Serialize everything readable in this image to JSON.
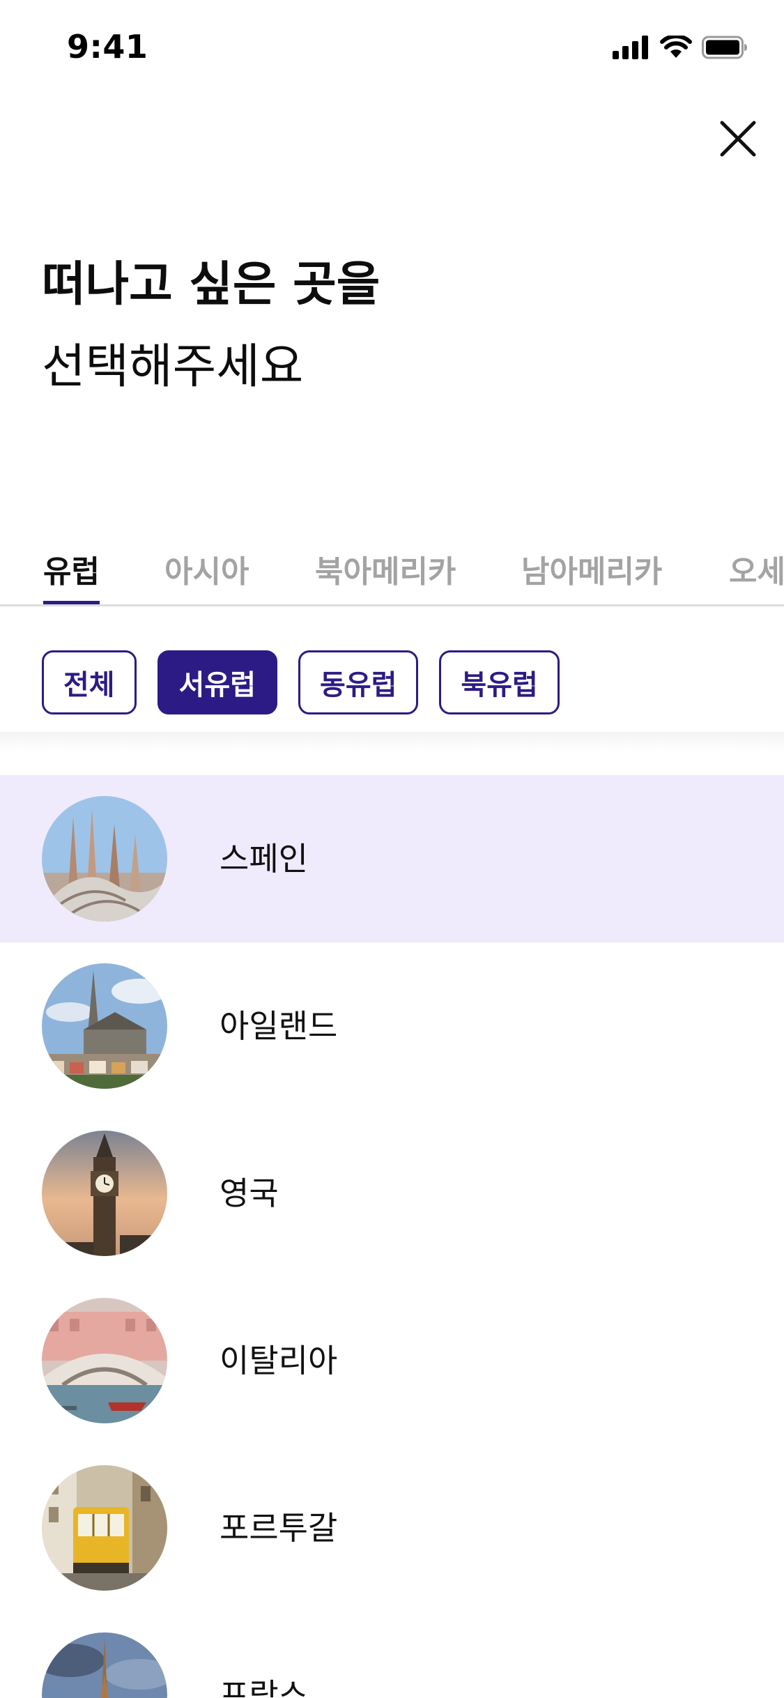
{
  "status_bar": {
    "time": "9:41",
    "icons": [
      "cellular-signal-icon",
      "wifi-icon",
      "battery-icon"
    ]
  },
  "close_icon": "close-icon",
  "title": {
    "line1": "떠나고 싶은 곳을",
    "line2": "선택해주세요"
  },
  "region_tabs": [
    {
      "label": "유럽",
      "active": true
    },
    {
      "label": "아시아",
      "active": false
    },
    {
      "label": "북아메리카",
      "active": false
    },
    {
      "label": "남아메리카",
      "active": false
    },
    {
      "label": "오세",
      "active": false
    }
  ],
  "sub_filters": [
    {
      "label": "전체",
      "selected": false
    },
    {
      "label": "서유럽",
      "selected": true
    },
    {
      "label": "동유럽",
      "selected": false
    },
    {
      "label": "북유럽",
      "selected": false
    }
  ],
  "countries": [
    {
      "name": "스페인",
      "selected": true,
      "image": "sagrada-familia-photo"
    },
    {
      "name": "아일랜드",
      "selected": false,
      "image": "cobh-cathedral-photo"
    },
    {
      "name": "영국",
      "selected": false,
      "image": "big-ben-photo"
    },
    {
      "name": "이탈리아",
      "selected": false,
      "image": "rialto-bridge-photo"
    },
    {
      "name": "포르투갈",
      "selected": false,
      "image": "lisbon-tram-photo"
    },
    {
      "name": "프랑스",
      "selected": false,
      "image": "eiffel-tower-photo"
    }
  ],
  "colors": {
    "accent": "#2d1b85",
    "selected_row_bg": "#efebfd",
    "inactive_tab": "#a3a3a3"
  }
}
